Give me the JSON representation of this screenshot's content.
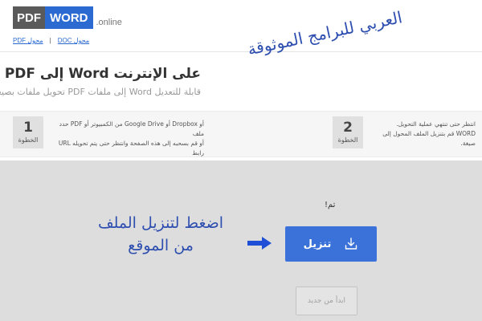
{
  "logo": {
    "pdf": "PDF",
    "word": "WORD",
    "suffix": ".online"
  },
  "converters": {
    "pdf": "PDF محول",
    "doc": "DOC محول",
    "separator": "|"
  },
  "watermark": "العربي للبرامج الموثوقة",
  "title": "على الإنترنت Word إلى PDF",
  "subtitle": "قابلة للتعديل Word إلى ملفات PDF تحويل ملفات بصيغة",
  "steps": [
    {
      "number": "1",
      "label": "الخطوة",
      "text": "أو Dropbox أو Google Drive من الكمبيوتر أو PDF حدد ملف\nأو قم بسحبه إلى هذه الصفحة وانتظر حتى يتم تحويله URL رابط"
    },
    {
      "number": "2",
      "label": "الخطوة",
      "text": "انتظر حتى تنتهي عملية التحويل.\nWORD قم بتنزيل الملف المحول إلى صيغة."
    }
  ],
  "result": {
    "status": "!تم",
    "download_label": "تنزيل",
    "restart_label": "ابدأ من جديد"
  },
  "annotation": {
    "line1": "اضغط لتنزيل الملف",
    "line2": "من الموقع"
  },
  "colors": {
    "brand_blue": "#2a6ad1",
    "button_blue": "#3b72d9",
    "annotation_blue": "#2f4fb0",
    "arrow_blue": "#1f4fd6"
  },
  "icons": {
    "download": "download-icon",
    "arrow": "arrow-right-icon"
  }
}
